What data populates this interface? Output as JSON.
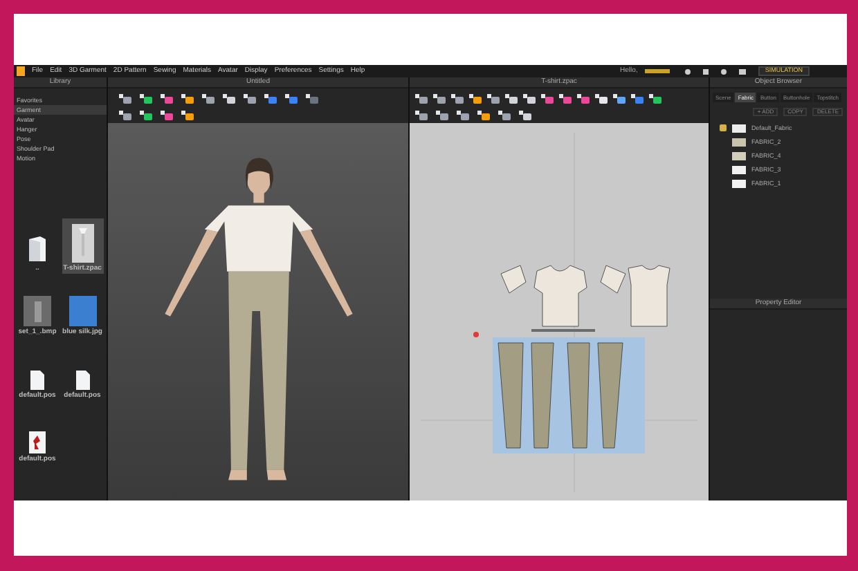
{
  "menu": [
    "File",
    "Edit",
    "3D Garment",
    "2D Pattern",
    "Sewing",
    "Materials",
    "Avatar",
    "Display",
    "Preferences",
    "Settings",
    "Help"
  ],
  "user": {
    "greeting": "Hello,"
  },
  "simulation_button": {
    "label": "SIMULATION"
  },
  "library": {
    "title": "Library",
    "categories": [
      {
        "label": "Favorites",
        "selected": false
      },
      {
        "label": "Garment",
        "selected": true
      },
      {
        "label": "Avatar",
        "selected": false
      },
      {
        "label": "Hanger",
        "selected": false
      },
      {
        "label": "Pose",
        "selected": false
      },
      {
        "label": "Shoulder Pad",
        "selected": false
      },
      {
        "label": "Motion",
        "selected": false
      }
    ],
    "files": [
      {
        "name": "..",
        "kind": "folder",
        "selected": false
      },
      {
        "name": "T-shirt.zpac",
        "kind": "garment",
        "selected": true
      },
      {
        "name": "set_1_.bmp",
        "kind": "image",
        "selected": false
      },
      {
        "name": "blue silk.jpg",
        "kind": "color",
        "selected": false
      },
      {
        "name": "default.pos",
        "kind": "document",
        "selected": false
      },
      {
        "name": "default.pos",
        "kind": "document",
        "selected": false
      },
      {
        "name": "default.pos",
        "kind": "pose",
        "selected": false
      }
    ]
  },
  "viewport_3d": {
    "title": "Untitled"
  },
  "viewport_2d": {
    "title": "T-shirt.zpac"
  },
  "object_browser": {
    "title": "Object Browser",
    "tabs": [
      {
        "label": "Scene",
        "selected": false
      },
      {
        "label": "Fabric",
        "selected": true
      },
      {
        "label": "Button",
        "selected": false
      },
      {
        "label": "Buttonhole",
        "selected": false
      },
      {
        "label": "Topstitch",
        "selected": false
      }
    ],
    "actions": [
      "+ ADD",
      "COPY",
      "DELETE"
    ],
    "fabrics": [
      {
        "name": "Default_Fabric",
        "checked": true,
        "color": "#ececec"
      },
      {
        "name": "FABRIC_2",
        "checked": false,
        "color": "#c9c2ad"
      },
      {
        "name": "FABRIC_4",
        "checked": false,
        "color": "#d2ccba"
      },
      {
        "name": "FABRIC_3",
        "checked": false,
        "color": "#f2f2f2"
      },
      {
        "name": "FABRIC_1",
        "checked": false,
        "color": "#f2f2f2"
      }
    ]
  },
  "property_editor": {
    "title": "Property Editor"
  }
}
